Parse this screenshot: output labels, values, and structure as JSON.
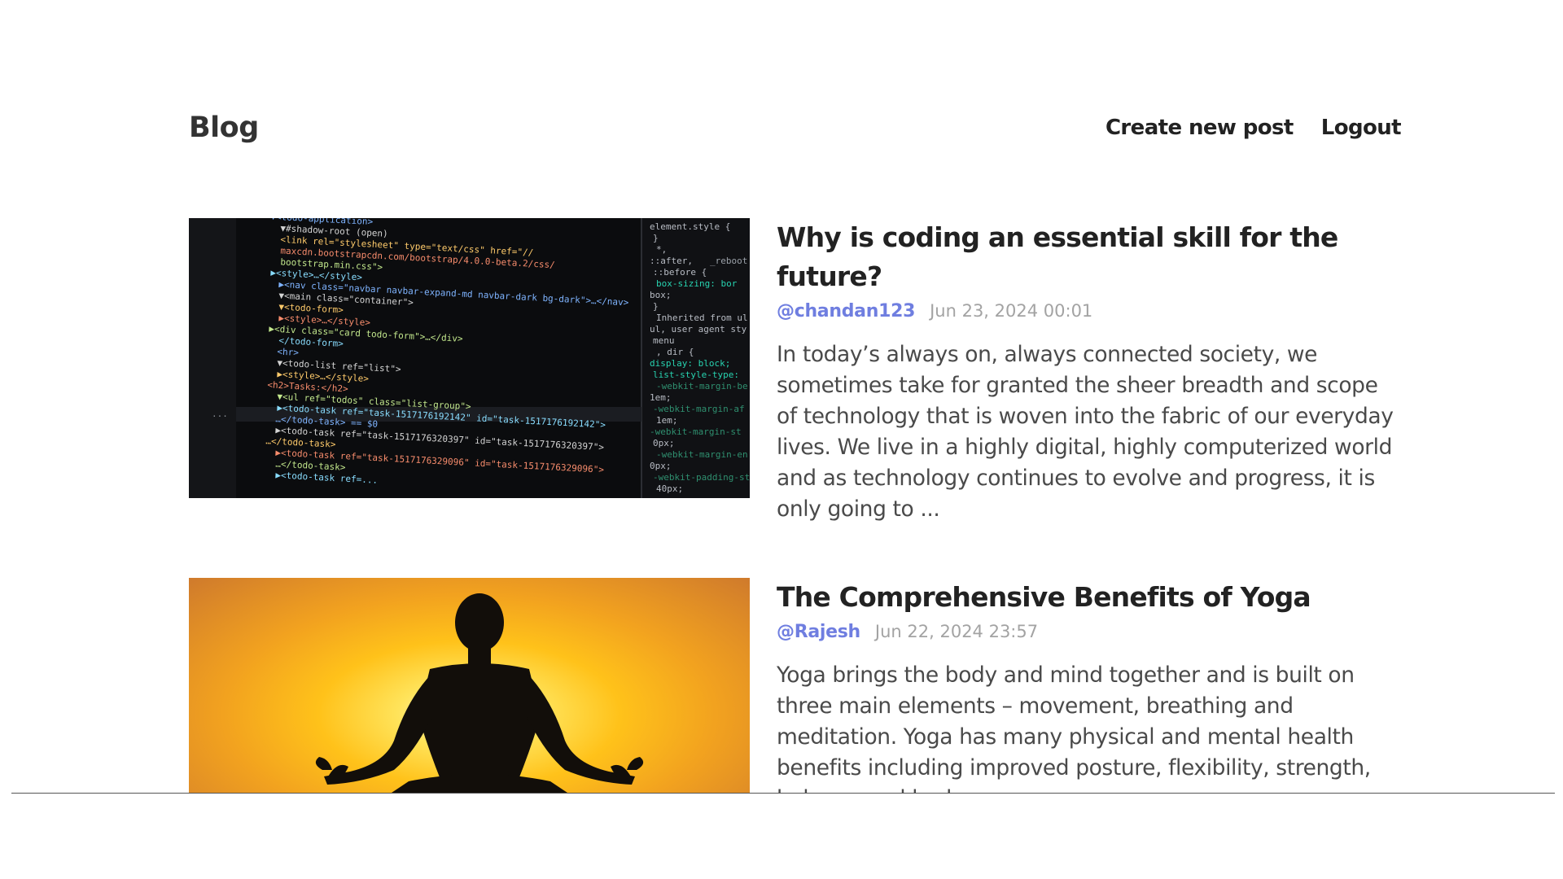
{
  "header": {
    "brand": "Blog",
    "nav": {
      "create_post": "Create new post",
      "logout": "Logout"
    }
  },
  "posts": [
    {
      "title": "Why is coding an essential skill for the future?",
      "author": "@chandan123",
      "date": "Jun 23, 2024 00:01",
      "excerpt": "In today’s always on, always connected society, we sometimes take for granted the sheer breadth and scope of technology that is woven into the fabric of our everyday lives. We live in a highly digital, highly computerized world and as technology continues to evolve and progress, it is only going to ...",
      "image": "code-screenshot",
      "image_text": {
        "lines": [
          "▼<todo-application>",
          "▼#shadow-root (open)",
          "<link rel=\"stylesheet\" type=\"text/css\" href=\"//",
          "maxcdn.bootstrapcdn.com/bootstrap/4.0.0-beta.2/css/",
          "bootstrap.min.css\">",
          "▶<style>…</style>",
          "▶<nav class=\"navbar navbar-expand-md navbar-dark bg-dark\">…</nav>",
          "▼<main class=\"container\">",
          "▼<todo-form>",
          "▶<style>…</style>",
          "▶<div class=\"card todo-form\">…</div>",
          "</todo-form>",
          "<hr>",
          "▼<todo-list ref=\"list\">",
          "▶<style>…</style>",
          "<h2>Tasks:</h2>",
          "▼<ul ref=\"todos\" class=\"list-group\">",
          "▶<todo-task ref=\"task-1517176192142\" id=\"task-1517176192142\">",
          "…</todo-task> == $0",
          "▶<todo-task ref=\"task-1517176320397\" id=\"task-1517176320397\">",
          "…</todo-task>",
          "▶<todo-task ref=\"task-1517176329096\" id=\"task-1517176329096\">",
          "…</todo-task>",
          "▶<todo-task ref=..."
        ],
        "side": [
          "element.style {",
          "}",
          "*,",
          "::after,",
          "::before {",
          "box-sizing: bor",
          "box;",
          "}",
          "Inherited from ul.lis",
          "ul,  user agent sty",
          "menu",
          ", dir {",
          "display: block;",
          "list-style-type:",
          "-webkit-margin-be",
          "1em;",
          "-webkit-margin-af",
          "1em;",
          "-webkit-margin-st",
          "0px;",
          "-webkit-margin-en",
          "0px;",
          "-webkit-padding-st",
          "40px;"
        ],
        "reboot": "_reboot",
        "dots": "..."
      }
    },
    {
      "title": "The Comprehensive Benefits of Yoga",
      "author": "@Rajesh",
      "date": "Jun 22, 2024 23:57",
      "excerpt": "Yoga brings the body and mind together and is built on three main elements – movement, breathing and meditation. Yoga has many physical and mental health benefits including improved posture, flexibility, strength, balance and body awareness.",
      "image": "yoga-silhouette"
    }
  ],
  "colors": {
    "author_link": "#6f7ee0",
    "date": "#a3a3a3",
    "title": "#222222",
    "body": "#4a4a4a"
  }
}
